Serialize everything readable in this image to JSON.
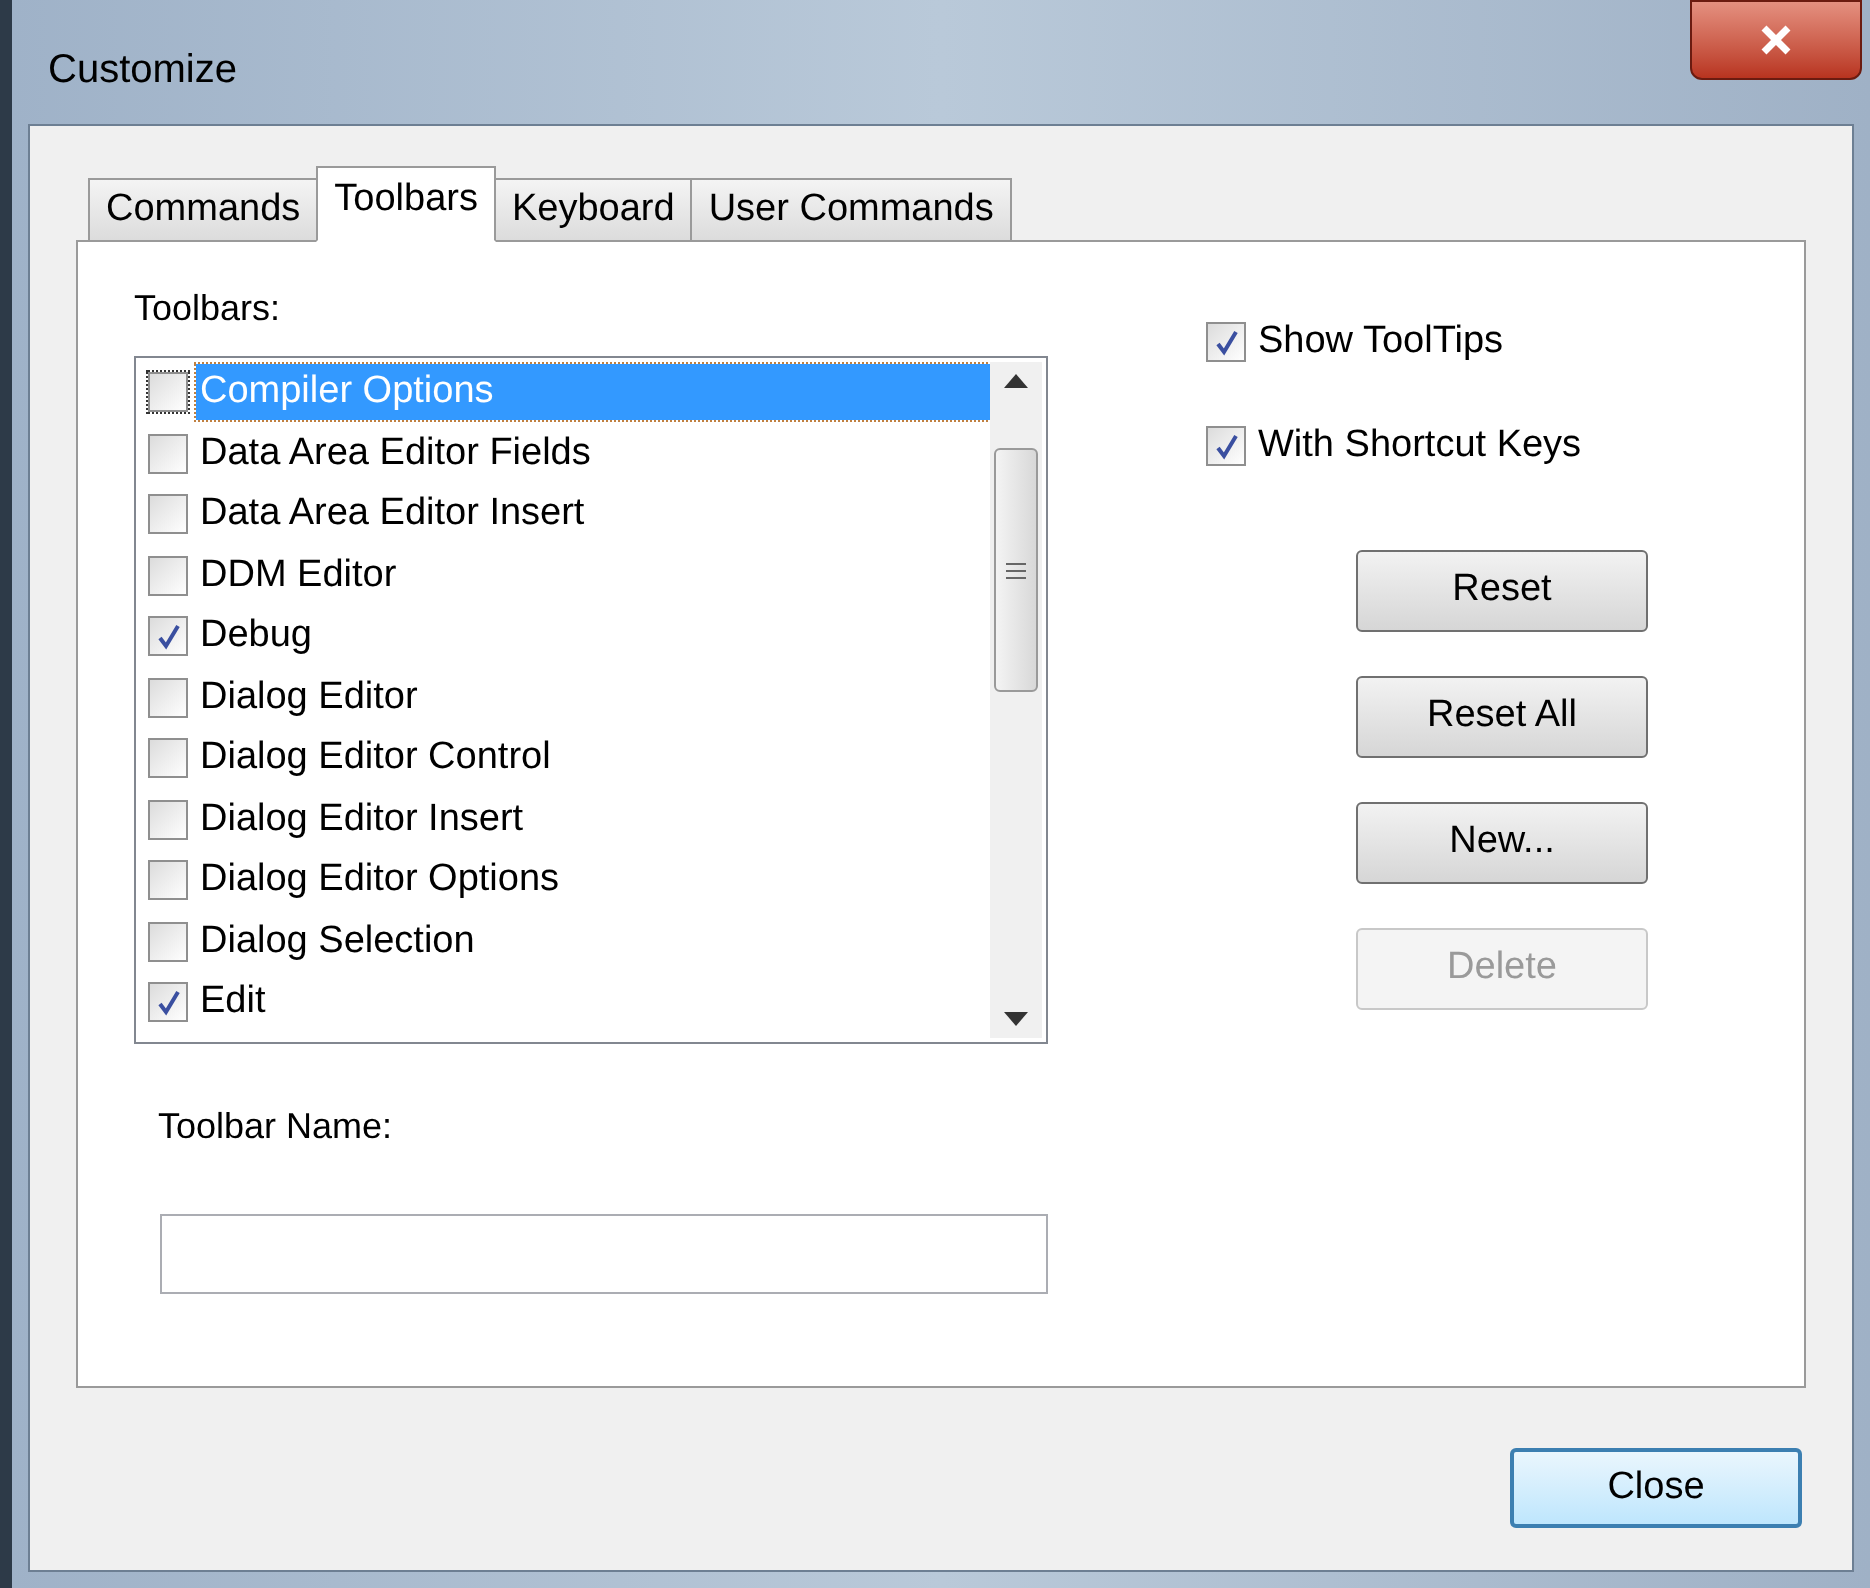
{
  "window": {
    "title": "Customize"
  },
  "tabs": [
    {
      "label": "Commands",
      "selected": false
    },
    {
      "label": "Toolbars",
      "selected": true
    },
    {
      "label": "Keyboard",
      "selected": false
    },
    {
      "label": "User Commands",
      "selected": false
    }
  ],
  "toolbars_label": "Toolbars:",
  "toolbars": [
    {
      "label": "Compiler Options",
      "checked": false,
      "selected": true
    },
    {
      "label": "Data Area Editor Fields",
      "checked": false,
      "selected": false
    },
    {
      "label": "Data Area Editor Insert",
      "checked": false,
      "selected": false
    },
    {
      "label": "DDM Editor",
      "checked": false,
      "selected": false
    },
    {
      "label": "Debug",
      "checked": true,
      "selected": false
    },
    {
      "label": "Dialog Editor",
      "checked": false,
      "selected": false
    },
    {
      "label": "Dialog Editor Control",
      "checked": false,
      "selected": false
    },
    {
      "label": "Dialog Editor Insert",
      "checked": false,
      "selected": false
    },
    {
      "label": "Dialog Editor Options",
      "checked": false,
      "selected": false
    },
    {
      "label": "Dialog Selection",
      "checked": false,
      "selected": false
    },
    {
      "label": "Edit",
      "checked": true,
      "selected": false
    }
  ],
  "options": [
    {
      "label": "Show ToolTips",
      "checked": true
    },
    {
      "label": "With Shortcut Keys",
      "checked": true
    }
  ],
  "buttons": [
    {
      "label": "Reset",
      "disabled": false
    },
    {
      "label": "Reset All",
      "disabled": false
    },
    {
      "label": "New...",
      "disabled": false
    },
    {
      "label": "Delete",
      "disabled": true
    }
  ],
  "toolbar_name": {
    "label": "Toolbar Name:"
  },
  "close_button": "Close"
}
